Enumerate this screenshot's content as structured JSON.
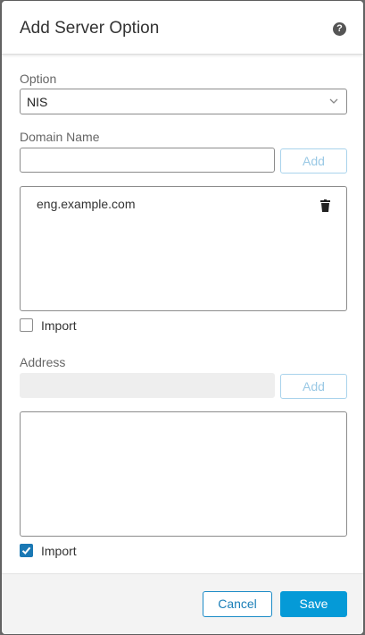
{
  "dialog": {
    "title": "Add Server Option",
    "help_icon": "question-circle-icon"
  },
  "option": {
    "label": "Option",
    "selected": "NIS",
    "icon": "chevron-down-icon"
  },
  "domain": {
    "label": "Domain Name",
    "input_value": "",
    "input_placeholder": "",
    "add_label": "Add",
    "items": [
      "eng.example.com"
    ],
    "item_icon": "trash-icon",
    "import_label": "Import",
    "import_checked": false
  },
  "address": {
    "label": "Address",
    "input_value": "",
    "input_placeholder": "",
    "add_label": "Add",
    "items": [],
    "import_label": "Import",
    "import_checked": true
  },
  "footer": {
    "cancel_label": "Cancel",
    "save_label": "Save"
  },
  "colors": {
    "primary": "#059ad7",
    "checkbox_checked": "#1a78b4",
    "disabled_button_text": "#9ac9e5"
  }
}
